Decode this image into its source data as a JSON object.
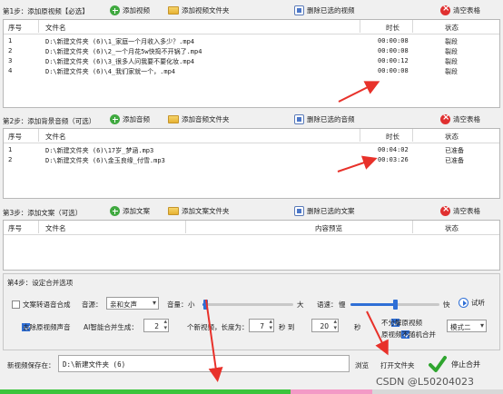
{
  "step1": {
    "title": "第1步：添加原视频【必选】",
    "buttons": {
      "add": "添加视频",
      "add_folder": "添加视频文件夹",
      "delete_selected": "删除已选的视频",
      "clear": "清空表格"
    },
    "columns": {
      "no": "序号",
      "name": "文件名",
      "duration": "时长",
      "status": "状态"
    },
    "rows": [
      {
        "no": "1",
        "name": "D:\\新建文件夹 (6)\\1_家庭一个月收入多少？.mp4",
        "duration": "00:00:08",
        "status": "裂段"
      },
      {
        "no": "2",
        "name": "D:\\新建文件夹 (6)\\2_一个月花5w快捣不开锅了.mp4",
        "duration": "00:00:08",
        "status": "裂段"
      },
      {
        "no": "3",
        "name": "D:\\新建文件夹 (6)\\3_很多人问我要不要化妆.mp4",
        "duration": "00:00:12",
        "status": "裂段"
      },
      {
        "no": "4",
        "name": "D:\\新建文件夹 (6)\\4_我们家就一个，.mp4",
        "duration": "00:00:08",
        "status": "裂段"
      }
    ]
  },
  "step2": {
    "title": "第2步：添加背景音频（可选）",
    "buttons": {
      "add": "添加音频",
      "add_folder": "添加音频文件夹",
      "delete_selected": "删除已选的音频",
      "clear": "清空表格"
    },
    "columns": {
      "no": "序号",
      "name": "文件名",
      "duration": "时长",
      "status": "状态"
    },
    "rows": [
      {
        "no": "1",
        "name": "D:\\新建文件夹 (6)\\17岁_梦涵.mp3",
        "duration": "00:04:02",
        "status": "已准备"
      },
      {
        "no": "2",
        "name": "D:\\新建文件夹 (6)\\金玉良缘_付雪.mp3",
        "duration": "00:03:26",
        "status": "已准备"
      }
    ]
  },
  "step3": {
    "title": "第3步：添加文案（可选）",
    "buttons": {
      "add": "添加文案",
      "add_folder": "添加文案文件夹",
      "delete_selected": "删除已选的文案",
      "clear": "清空表格"
    },
    "columns": {
      "no": "序号",
      "name": "文件名",
      "preview": "内容预览",
      "status": "状态"
    }
  },
  "step4": {
    "title": "第4步：设定合并选项",
    "tts_label": "文案转语音合成",
    "voice_label": "音源：",
    "voice_value": "亲和女声",
    "volume_label": "音量：",
    "volume_small": "小",
    "volume_large": "大",
    "volume_level": 0.03,
    "speed_label": "语速：",
    "speed_slow": "慢",
    "speed_fast": "快",
    "speed_level": 0.5,
    "preview_label": "试听",
    "remove_audio_label": "去除原视频声音",
    "ai_merge_label": "AI智能合并生成：",
    "count_value": "2",
    "count_suffix": "个新视频，长度为：",
    "min_value": "7",
    "sec_to": "秒 到",
    "max_value": "20",
    "sec_suffix": "秒",
    "no_split_label": "不分解原视频",
    "no_random_label": "原视频不随机合并",
    "mode_value": "模式二",
    "tts_checked": false,
    "remove_audio_checked": true,
    "no_split_checked": true,
    "no_random_checked": true
  },
  "save": {
    "label": "新视频保存在：",
    "path": "D:\\新建文件夹 (6)",
    "browse": "浏览",
    "open_folder": "打开文件夹",
    "start": "停止合并"
  },
  "watermark": "CSDN @L50204023",
  "colors": {
    "progress": "#3cc43c",
    "progress_pink": "#f39ac6",
    "accent": "#2f6fd6",
    "arrow": "#e8312a"
  }
}
